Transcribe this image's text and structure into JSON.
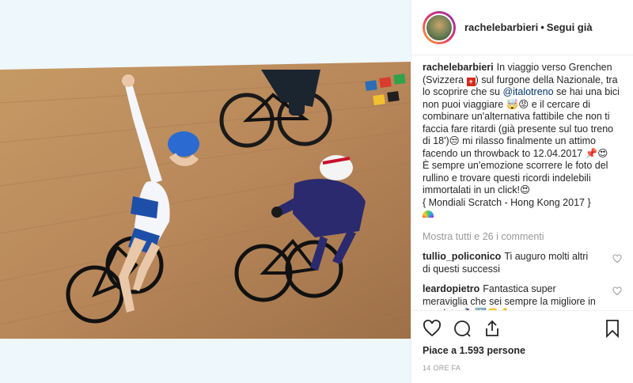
{
  "header": {
    "username": "rachelebarbieri",
    "separator": "•",
    "follow_label": "Segui già"
  },
  "caption": {
    "username": "rachelebarbieri",
    "part1": "In viaggio verso Grenchen (Svizzera ",
    "part2": ") sul furgone della Nazionale, tra lo scoprire che su ",
    "mention": "@italotreno",
    "part3": " se hai una bici non puoi viaggiare 🤯😡 e il cercare di combinare un'alternativa fattibile che non ti faccia fare ritardi (già presente sul tuo treno di 18')😒 mi rilasso finalmente un attimo facendo un throwback to 12.04.2017 📌😍",
    "part4": "È sempre un'emozione scorrere le foto del rullino e trovare questi ricordi indelebili immortalati in un click!😍",
    "part5": "{ Mondiali Scratch - Hong Kong 2017 }",
    "flag_glyph": "+"
  },
  "more_comments": "Mostra tutti e 26 i commenti",
  "comments": [
    {
      "username": "tullio_policonico",
      "text": "Ti auguro molti altri di questi successi"
    },
    {
      "username": "leardopietro",
      "text": "Fantastica super meraviglia che sei sempre la migliore in assoluto 🚴‍♀️⬆️🙂💪"
    }
  ],
  "likes": "Piace a 1.593 persone",
  "time": "14 ORE FA",
  "icons": {
    "like": "heart-icon",
    "comment": "comment-bubble-icon",
    "share": "share-icon",
    "save": "bookmark-icon"
  },
  "colors": {
    "track": "#b08a5d",
    "italy_jersey": "#1e4fa8",
    "usa_jersey": "#2b2a6e",
    "mention": "#003569",
    "muted": "#999999"
  }
}
